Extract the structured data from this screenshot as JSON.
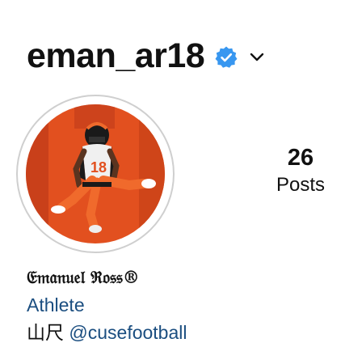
{
  "profile": {
    "username": "eman_ar18",
    "verified_icon": "verified-badge-icon",
    "switch_account_icon": "chevron-down-icon",
    "verified_color": "#3897f0"
  },
  "avatar": {
    "icon": "profile-photo"
  },
  "stats": {
    "posts_count": "26",
    "posts_label": "Posts"
  },
  "bio": {
    "display_name": "𝔈𝔪𝔞𝔫𝔲𝔢𝔩 ℜ𝔬𝔰𝔰®",
    "category": "Athlete",
    "line_prefix": "山尺",
    "mention": "@cusefootball"
  },
  "colors": {
    "link": "#1b4e80",
    "avatar_bg": "#e2501f",
    "ring": "#cfcfcf"
  }
}
